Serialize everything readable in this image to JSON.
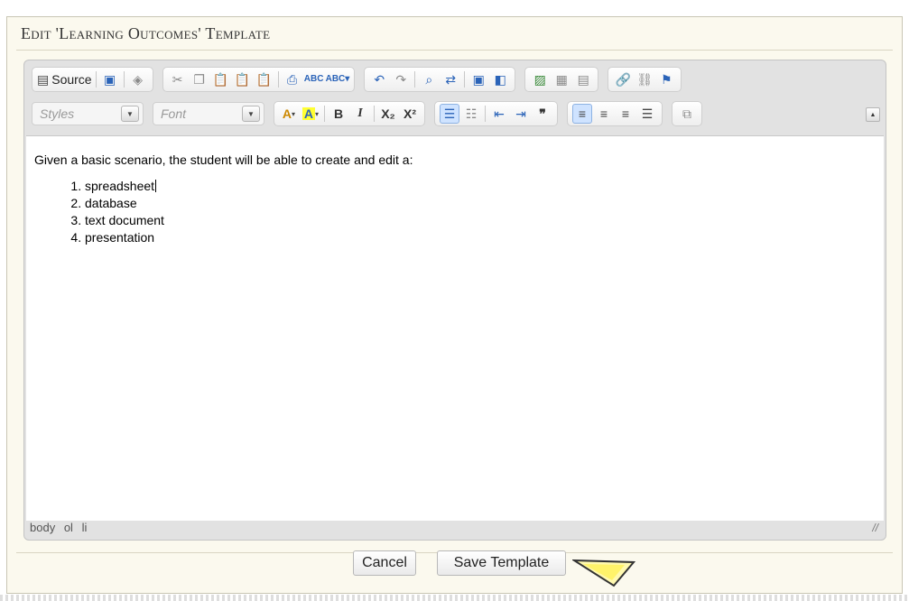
{
  "dialog": {
    "title": "Edit 'Learning Outcomes' Template"
  },
  "toolbar": {
    "source_label": "Source",
    "styles_placeholder": "Styles",
    "font_placeholder": "Font",
    "text_color_label": "A",
    "bg_color_label": "A",
    "bold_label": "B",
    "italic_label": "I",
    "subscript_label": "X₂",
    "superscript_label": "X²",
    "blockquote_label": "❞"
  },
  "content": {
    "intro": "Given a basic scenario, the student will be able to create and edit a:",
    "items": [
      "spreadsheet",
      "database",
      "text document",
      "presentation"
    ]
  },
  "statusbar": {
    "path": [
      "body",
      "ol",
      "li"
    ]
  },
  "buttons": {
    "cancel": "Cancel",
    "save": "Save Template"
  },
  "colors": {
    "dialog_bg": "#fbf9ee",
    "toolbar_bg": "#e2e2e2",
    "active_button": "#cfe3ff",
    "pointer_fill": "#fff9b0"
  }
}
